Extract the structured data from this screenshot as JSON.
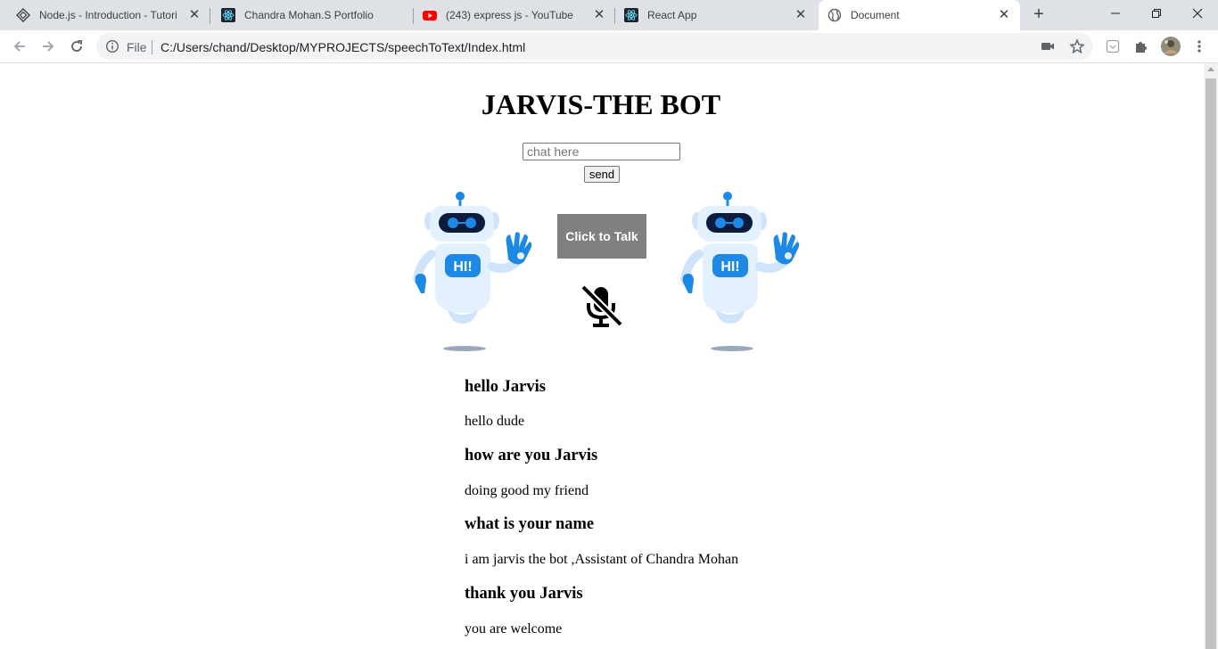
{
  "browser": {
    "tabs": [
      {
        "title": "Node.js - Introduction - Tutori",
        "icon": "tutorialspoint-icon",
        "active": false
      },
      {
        "title": "Chandra Mohan.S Portfolio",
        "icon": "react-icon",
        "active": false
      },
      {
        "title": "(243) express js - YouTube",
        "icon": "youtube-icon",
        "active": false
      },
      {
        "title": "React App",
        "icon": "react-icon",
        "active": false
      },
      {
        "title": "Document",
        "icon": "globe-icon",
        "active": true
      }
    ],
    "address": {
      "scheme_label": "File",
      "url": "C:/Users/chand/Desktop/MYPROJECTS/speechToText/Index.html"
    }
  },
  "page": {
    "title": "JARVIS-THE BOT",
    "chat_placeholder": "chat here",
    "send_label": "send",
    "talk_label": "Click to Talk",
    "robot_badge": "HI!",
    "transcript": [
      {
        "question": "hello Jarvis",
        "answer": "hello dude"
      },
      {
        "question": "how are you Jarvis",
        "answer": "doing good my friend"
      },
      {
        "question": "what is your name",
        "answer": "i am jarvis the bot ,Assistant of Chandra Mohan"
      },
      {
        "question": "thank you Jarvis",
        "answer": "you are welcome"
      }
    ]
  },
  "colors": {
    "tabstrip": "#dee1e6",
    "talk_button": "#808080",
    "robot_blue": "#1e88e5",
    "robot_light": "#cfe4fb"
  }
}
